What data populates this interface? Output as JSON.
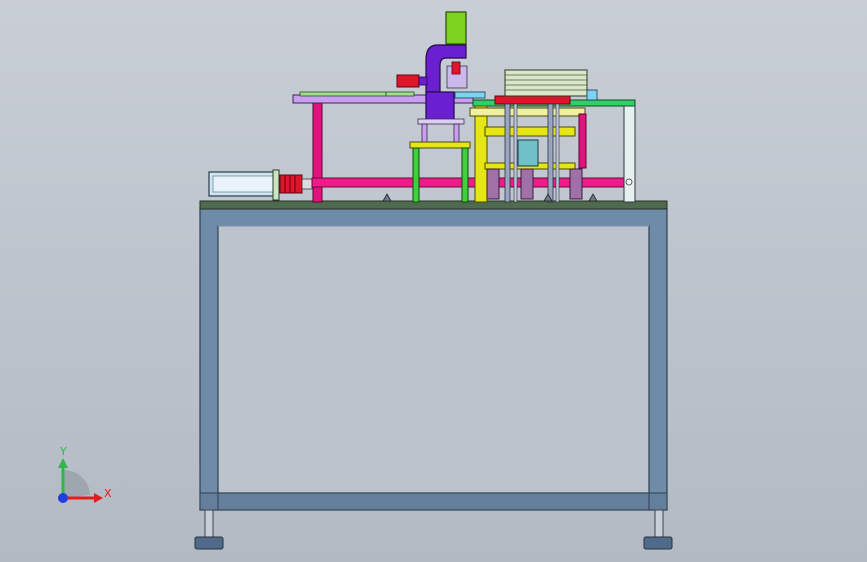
{
  "triad": {
    "x_label": "X",
    "y_label": "Y",
    "x_color": "#e01e1e",
    "y_color": "#2fb84a",
    "z_color": "#1e3fe0"
  },
  "colors": {
    "background_top": "#c9ced6",
    "background_bottom": "#b3bac4",
    "frame_steel": "#6c8aa8",
    "frame_edge": "#34475a",
    "table_top": "#4c6a4c",
    "magenta_frame": "#e0147e",
    "pink_shaft": "#f01a8a",
    "purple_press": "#6a1fd0",
    "green_cylinder": "#7ed321",
    "yellow_frame": "#e6e614",
    "lavender_plate": "#c9a0f0",
    "light_green_plate": "#9ee08a",
    "motor_body": "#c9e6f2",
    "red_part": "#e0142a",
    "cyan_block": "#6fc0c8",
    "light_rails": "#e6f0e0"
  },
  "model": {
    "view": "front",
    "parts": [
      "base-frame",
      "table-top",
      "leveling-feet",
      "servo-motor",
      "coupling",
      "drive-shaft",
      "press-column",
      "press-cylinder",
      "upper-plate",
      "yellow-guide-frame",
      "stacked-plates",
      "guide-rods"
    ]
  }
}
